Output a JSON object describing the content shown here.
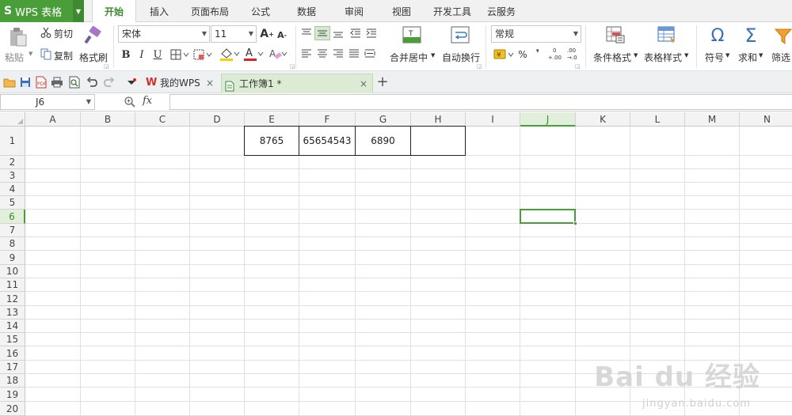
{
  "app": {
    "logo": "S",
    "title": "WPS 表格"
  },
  "tabs": [
    {
      "label": "开始"
    },
    {
      "label": "插入"
    },
    {
      "label": "页面布局"
    },
    {
      "label": "公式"
    },
    {
      "label": "数据"
    },
    {
      "label": "审阅"
    },
    {
      "label": "视图"
    },
    {
      "label": "开发工具"
    },
    {
      "label": "云服务"
    }
  ],
  "ribbon": {
    "paste": "粘贴",
    "cut": "剪切",
    "copy": "复制",
    "format_painter": "格式刷",
    "font_name": "宋体",
    "font_size": "11",
    "bold": "B",
    "italic": "I",
    "underline": "U",
    "merge_center": "合并居中",
    "wrap_text": "自动换行",
    "number_format": "常规",
    "percent": "%",
    "thousands": "❜",
    "conditional_format": "条件格式",
    "table_style": "表格样式",
    "symbol": "符号",
    "sum": "求和",
    "filter": "筛选"
  },
  "doc_tabs": [
    {
      "label": "我的WPS",
      "close": "×"
    },
    {
      "label": "工作簿1 *",
      "close": "×"
    }
  ],
  "new_tab": "+",
  "formula_bar": {
    "name_box": "J6",
    "fx": "fx",
    "value": ""
  },
  "sheet": {
    "columns": [
      "A",
      "B",
      "C",
      "D",
      "E",
      "F",
      "G",
      "H",
      "I",
      "J",
      "K",
      "L",
      "M",
      "N"
    ],
    "rows": [
      "1",
      "2",
      "3",
      "4",
      "5",
      "6",
      "7",
      "8",
      "9",
      "10",
      "11",
      "12",
      "13",
      "14",
      "15",
      "16",
      "17",
      "18",
      "19",
      "20"
    ],
    "selected_cell": "J6",
    "cells": {
      "E1": "8765",
      "F1": "65654543",
      "G1": "6890",
      "H1": ""
    }
  },
  "watermark": {
    "main": "Bai du 经验",
    "sub": "jingyan.baidu.com"
  },
  "colors": {
    "accent": "#4a9e3a",
    "tab_active_text": "#3a8a2e"
  }
}
